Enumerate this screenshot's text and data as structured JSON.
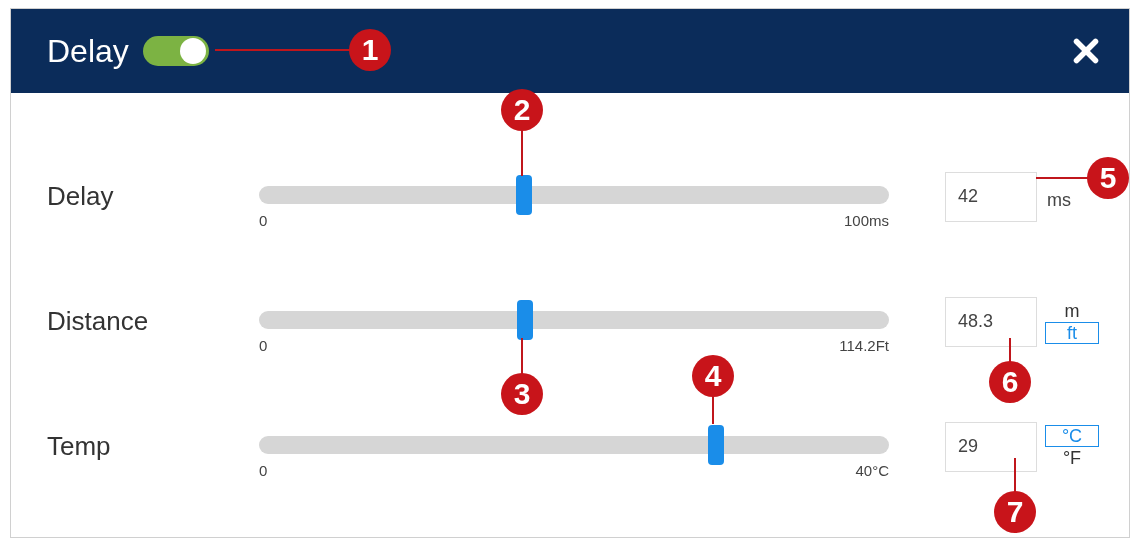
{
  "header": {
    "title": "Delay",
    "toggle_on": true
  },
  "rows": [
    {
      "label": "Delay",
      "level": 0.42,
      "min": "0",
      "max": "100ms",
      "value": "42",
      "unit": "ms"
    },
    {
      "label": "Distance",
      "level": 0.423,
      "min": "0",
      "max": "114.2Ft",
      "value": "48.3",
      "units": [
        {
          "label": "m",
          "selected": false
        },
        {
          "label": "ft",
          "selected": true
        }
      ]
    },
    {
      "label": "Temp",
      "level": 0.725,
      "min": "0",
      "max": "40°C",
      "value": "29",
      "units": [
        {
          "label": "°C",
          "selected": true
        },
        {
          "label": "°F",
          "selected": false
        }
      ]
    }
  ],
  "callouts": [
    "1",
    "2",
    "3",
    "4",
    "5",
    "6",
    "7"
  ]
}
